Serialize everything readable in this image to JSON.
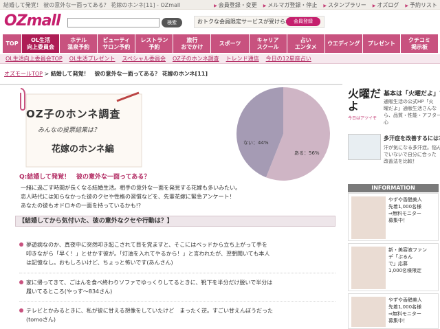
{
  "topbar": {
    "page_title": "結婚して発覚！ 彼の意外な一面ってある？ 花嫁のホンネ[11] - OZmall",
    "links": [
      "会員登録・変更",
      "メルマガ登録・停止",
      "スタンプラリー",
      "オズログ",
      "予約リスト"
    ]
  },
  "logo": "OZmall",
  "search": {
    "button": "検索",
    "placeholder": ""
  },
  "member": {
    "text": "おトクな会員限定サービスが受けられる",
    "button": "会員登録"
  },
  "nav": [
    "TOP",
    "OL生活\n向上委員会",
    "ホテル\n温泉予約",
    "ビューティ\nサロン予約",
    "レストラン\n予約",
    "旅行\nおでかけ",
    "スポーツ",
    "キャリア\nスクール",
    "占い\nエンタメ",
    "ウエディング",
    "プレゼント",
    "クチコミ\n掲示板"
  ],
  "subnav": [
    "OL生活向上委員会TOP",
    "OL生活プレゼント",
    "スペシャル委員会",
    "OZ子のホンネ調査",
    "トレンド通信",
    "今日の12星座占い"
  ],
  "breadcrumb": {
    "link": "オズモールTOP",
    "sep": " > ",
    "current": "結婚して発覚！　彼の意外な一面ってある？ 花嫁のホンネ[11]"
  },
  "header": {
    "line1": "OZ子のホンネ調査",
    "line2": "みんなの投票結果は？",
    "line3": "花嫁のホンネ編"
  },
  "chart_data": {
    "type": "pie",
    "values": [
      56,
      44
    ],
    "categories": [
      "ある",
      "ない"
    ],
    "labels": [
      "ある：56%",
      "ない：44%"
    ],
    "colors": [
      "#cfb5c5",
      "#a59bb4"
    ]
  },
  "question": "Q:結婚して発覚！　彼の意外な一面ってある？",
  "intro": [
    "一緒に過ごす時間が長くなる結婚生活。相手の意外な一面を発見する花嫁も多いみたい。",
    "恋人時代には知らなかった彼のクセや性格の習慣などを、先輩花嫁に緊急アンケート！",
    "あなたの彼もオドロキの一面を持っているかも!?"
  ],
  "section_title": "【結婚してから気付いた、彼の意外なクセや行動は？】",
  "items": [
    [
      "夢遊病なのか、真夜中に突然叩き起こされて目を覚ますと、そこにはベッドから立ち上がって手を",
      "叩きながら「早く！」とせかす彼が。「灯油を入れてやるから！」と言われたが、翌朝聞いても本人",
      "は記憶なし。おもしろいけど、ちょっと怖いです(あんさん)"
    ],
    [
      "家に帰ってきて、ごはんを食べ終わりソファでゆっくりしてるときに、靴下を半分だけ脱いで半分は",
      "履いてるところ(やっす～834さん)"
    ],
    [
      "テレビとかみるときに、私が彼に甘える想像をしていたけど　まったく逆。すごい甘えんぼうだった",
      "(tomoさん)"
    ]
  ],
  "side": {
    "badge": "火曜だよ",
    "badge_sub": "今日はアツイぞ",
    "title": "基本は「火曜だよ」で検索",
    "desc": [
      "通販生活の公式HP「火",
      "曜だよ」通販生活さんな",
      "ら、品質・性能・アフターも安",
      "心"
    ],
    "head2": "多汗症を改善するには？",
    "desc2": [
      "汗が気になる多汗症。悩ん",
      "でいないで自分に合った",
      "改善法を比較！"
    ],
    "info": "INFORMATION",
    "ad1": "やずや香醋美人\n先着1,000名様\n⇒無料モニター\n募集中！",
    "ad2": "新・美容液ファン\nデ「ぷるん\nで」応募\n1,000名様限定",
    "ad3": "やずや香醋美人\n先着1,000名様\n⇒無料モニター\n募集中！"
  }
}
